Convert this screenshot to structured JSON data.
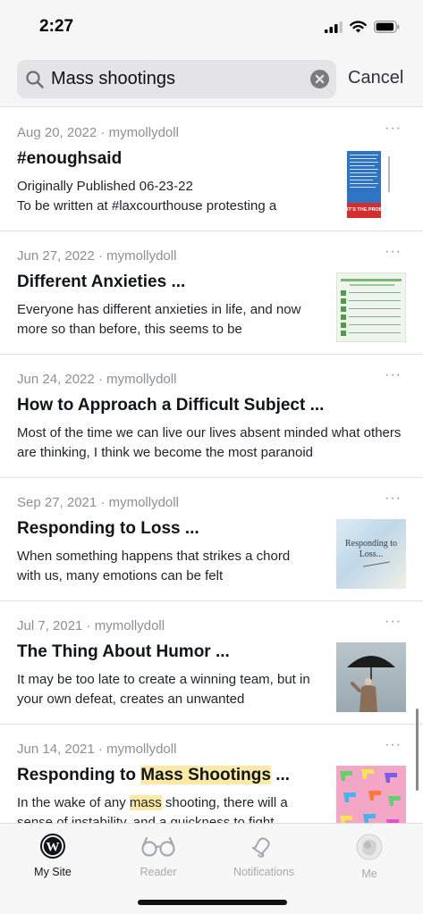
{
  "status": {
    "time": "2:27"
  },
  "search": {
    "query": "Mass shootings",
    "cancel_label": "Cancel"
  },
  "posts": [
    {
      "date": "Aug 20, 2022",
      "author": "mymollydoll",
      "title": "#enoughsaid",
      "excerpt": "Originally Published 06-23-22\nTo be written at #laxcourthouse protesting a",
      "thumb_text": "IT'S THE PROBLEM"
    },
    {
      "date": "Jun 27, 2022",
      "author": "mymollydoll",
      "title": "Different Anxieties ...",
      "excerpt": "Everyone has different anxieties in life, and now more so than before, this seems to be"
    },
    {
      "date": "Jun 24, 2022",
      "author": "mymollydoll",
      "title": "How to Approach a Difficult Subject ...",
      "excerpt": "Most of the time we can live our lives absent minded what others are thinking, I think we become the most paranoid"
    },
    {
      "date": "Sep 27, 2021",
      "author": "mymollydoll",
      "title": "Responding to Loss ...",
      "excerpt": "When something happens that strikes a chord with us, many emotions can be felt",
      "thumb_text": "Responding to Loss..."
    },
    {
      "date": "Jul 7, 2021",
      "author": "mymollydoll",
      "title": "The Thing About Humor ...",
      "excerpt": "It may be too late to create a winning team, but in your own defeat, creates an unwanted"
    },
    {
      "date": "Jun 14, 2021",
      "author": "mymollydoll",
      "title_pre": "Responding to ",
      "title_highlight": "Mass Shootings",
      "title_post": " ...",
      "excerpt_pre": "In the wake of any ",
      "excerpt_highlight": "mass",
      "excerpt_post": " shooting, there will a sense of instability, and a quickness to fight,"
    }
  ],
  "meta_separator": " · ",
  "more_label": "···",
  "tabs": [
    {
      "label": "My Site",
      "icon": "wordpress-icon",
      "active": true
    },
    {
      "label": "Reader",
      "icon": "glasses-icon",
      "active": false
    },
    {
      "label": "Notifications",
      "icon": "bell-icon",
      "active": false
    },
    {
      "label": "Me",
      "icon": "avatar",
      "active": false
    }
  ],
  "colors": {
    "highlight": "#fbe9a6",
    "text_secondary": "#8c8f94",
    "text_primary": "#101517"
  }
}
